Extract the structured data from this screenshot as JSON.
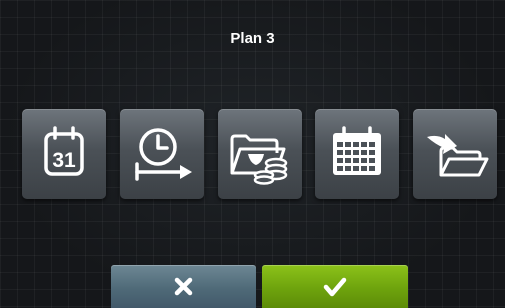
{
  "header": {
    "title": "Plan 3"
  },
  "tiles": [
    {
      "icon": "calendar-day-icon",
      "day_number": "31"
    },
    {
      "icon": "clock-duration-icon"
    },
    {
      "icon": "folder-coins-icon"
    },
    {
      "icon": "calendar-grid-icon"
    },
    {
      "icon": "import-folder-icon"
    }
  ],
  "footer": {
    "cancel_icon": "close-icon",
    "confirm_icon": "checkmark-icon"
  },
  "colors": {
    "cancel_button": "#536d7b",
    "confirm_button": "#72a90e",
    "tile": "#53595f"
  }
}
